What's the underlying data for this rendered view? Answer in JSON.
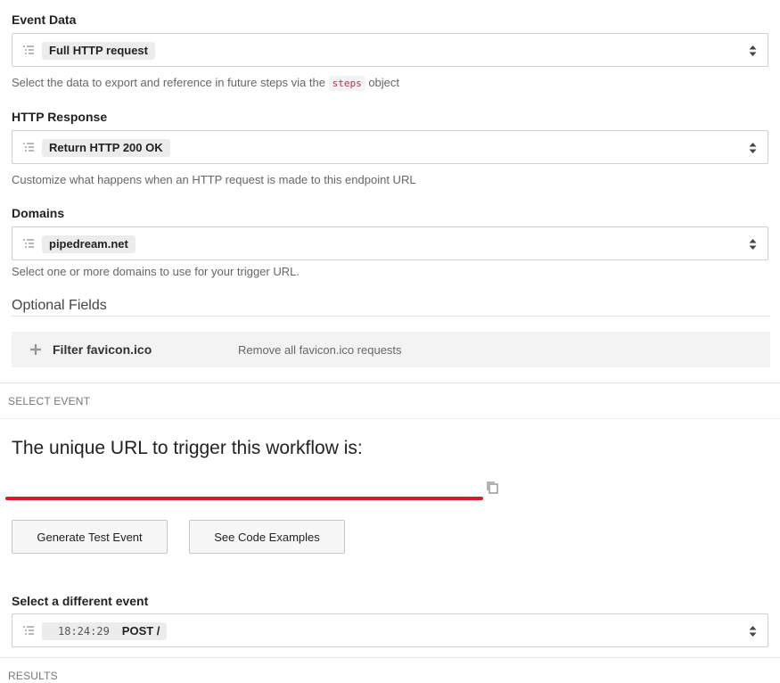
{
  "event_data": {
    "label": "Event Data",
    "value": "Full HTTP request",
    "hint_before": "Select the data to export and reference in future steps via the",
    "hint_code": "steps",
    "hint_after": "object"
  },
  "http_response": {
    "label": "HTTP Response",
    "value": "Return HTTP 200 OK",
    "hint": "Customize what happens when an HTTP request is made to this endpoint URL"
  },
  "domains": {
    "label": "Domains",
    "value": "pipedream.net",
    "hint": "Select one or more domains to use for your trigger URL."
  },
  "optional_fields": {
    "title": "Optional Fields",
    "filter_label": "Filter favicon.ico",
    "filter_desc": "Remove all favicon.ico requests"
  },
  "select_event": {
    "section_title": "SELECT EVENT",
    "url_title": "The unique URL to trigger this workflow is:",
    "generate_label": "Generate Test Event",
    "examples_label": "See Code Examples",
    "different_event_label": "Select a different event",
    "event_time": "18:24:29",
    "event_value": "POST /"
  },
  "results": {
    "section_title": "RESULTS"
  },
  "icons": {
    "list": "list-icon",
    "caret": "sort-caret-icon",
    "plus": "plus-icon",
    "copy": "copy-icon"
  },
  "colors": {
    "redaction": "#e0162b"
  }
}
